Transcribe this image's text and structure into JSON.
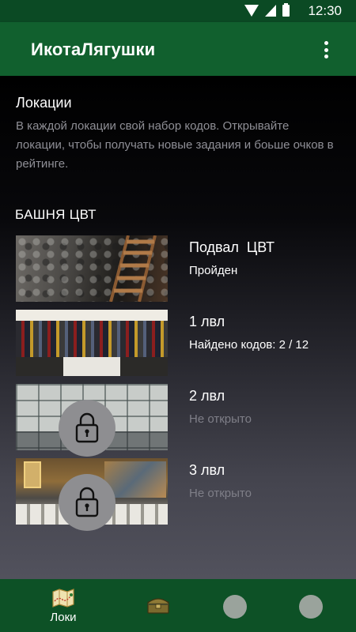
{
  "status_bar": {
    "time": "12:30"
  },
  "app_bar": {
    "title": "ИкотаЛягушки"
  },
  "intro": {
    "title": "Локации",
    "description": "В каждой локации свой набор кодов. Открывайте локации, чтобы получать новые задания и боьше очков в рейтинге."
  },
  "section": {
    "title": "БАШНЯ ЦВТ"
  },
  "locations": [
    {
      "name": "Подвал  ЦВТ",
      "status": "Пройден",
      "locked": false
    },
    {
      "name": "1 лвл",
      "status": "Найдено кодов: 2 / 12",
      "locked": false
    },
    {
      "name": "2 лвл",
      "status": "Не открыто",
      "locked": true
    },
    {
      "name": "3 лвл",
      "status": "Не открыто",
      "locked": true
    }
  ],
  "bottom_nav": {
    "items": [
      {
        "label": "Локи",
        "icon": "map-icon",
        "active": true
      },
      {
        "label": "",
        "icon": "chest-icon"
      },
      {
        "label": "",
        "icon": "circle-icon"
      },
      {
        "label": "",
        "icon": "circle-icon"
      }
    ]
  },
  "colors": {
    "app_bar": "#11602e",
    "status_bar": "#0b4a24",
    "bottom_nav": "#0d5126",
    "text_primary": "#ffffff",
    "text_secondary": "#8f8f96"
  }
}
